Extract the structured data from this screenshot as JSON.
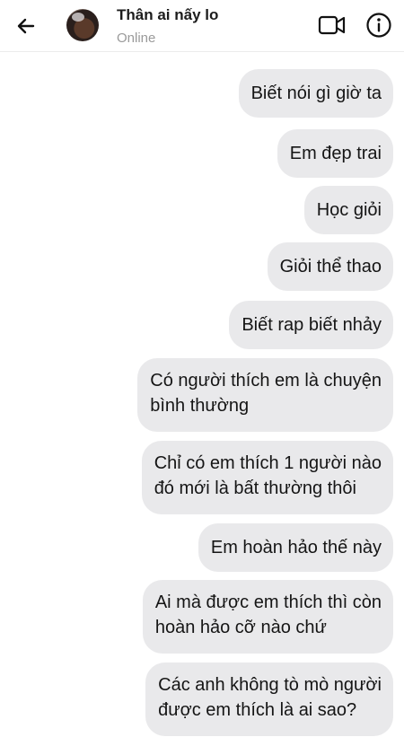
{
  "header": {
    "back_icon": "arrow-left-icon",
    "contact_name": "Thân ai nấy lo",
    "status": "Online",
    "video_icon": "video-camera-icon",
    "info_icon": "info-icon"
  },
  "messages": [
    {
      "text": "Biết nói gì giờ ta"
    },
    {
      "text": "Em đẹp trai"
    },
    {
      "text": "Học giỏi"
    },
    {
      "text": "Giỏi thể thao"
    },
    {
      "text": "Biết rap biết nhảy"
    },
    {
      "text": "Có người thích em là chuyện\nbình thường"
    },
    {
      "text": "Chỉ có em thích 1 người nào\nđó mới là bất thường thôi"
    },
    {
      "text": "Em hoàn hảo thế này"
    },
    {
      "text": "Ai mà được em thích thì còn\nhoàn hảo cỡ nào chứ"
    },
    {
      "text": "Các anh không tò mò người\nđược em thích là ai sao?"
    }
  ],
  "colors": {
    "bubble": "#e9e9eb",
    "text": "#151515",
    "status": "#9a9a9a"
  }
}
